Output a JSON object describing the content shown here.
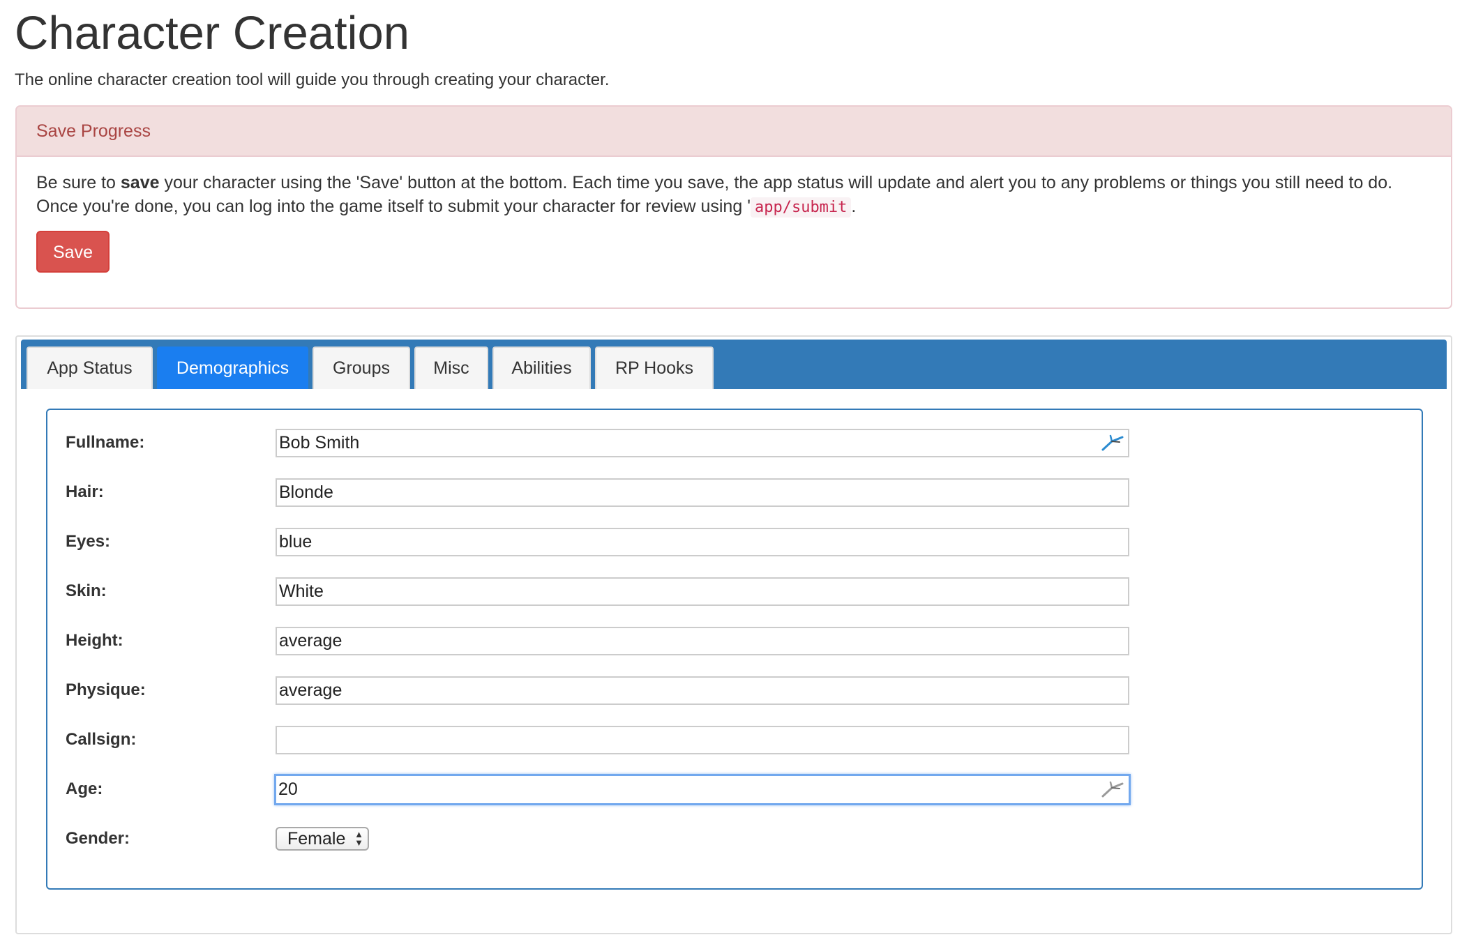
{
  "page": {
    "title": "Character Creation",
    "intro": "The online character creation tool will guide you through creating your character."
  },
  "save_panel": {
    "heading": "Save Progress",
    "text_before_bold": "Be sure to ",
    "bold": "save",
    "text_after_bold": " your character using the 'Save' button at the bottom. Each time you save, the app status will update and alert you to any problems or things you still need to do. Once you're done, you can log into the game itself to submit your character for review using '",
    "code": "app/submit",
    "text_end": ".",
    "button_label": "Save"
  },
  "tabs": [
    {
      "label": "App Status",
      "active": false
    },
    {
      "label": "Demographics",
      "active": true
    },
    {
      "label": "Groups",
      "active": false
    },
    {
      "label": "Misc",
      "active": false
    },
    {
      "label": "Abilities",
      "active": false
    },
    {
      "label": "RP Hooks",
      "active": false
    }
  ],
  "demographics": {
    "fields": [
      {
        "label": "Fullname:",
        "value": "Bob Smith"
      },
      {
        "label": "Hair:",
        "value": "Blonde"
      },
      {
        "label": "Eyes:",
        "value": "blue"
      },
      {
        "label": "Skin:",
        "value": "White"
      },
      {
        "label": "Height:",
        "value": "average"
      },
      {
        "label": "Physique:",
        "value": "average"
      },
      {
        "label": "Callsign:",
        "value": ""
      },
      {
        "label": "Age:",
        "value": "20"
      }
    ],
    "gender": {
      "label": "Gender:",
      "selected": "Female"
    }
  },
  "colors": {
    "tab_bar": "#337ab7",
    "active_tab": "#1a7ef0",
    "danger_heading_bg": "#f2dede",
    "danger_text": "#a94442",
    "save_button": "#d9534f",
    "code_text": "#c7254e"
  },
  "icons": {
    "input_addon": "pen-icon"
  }
}
